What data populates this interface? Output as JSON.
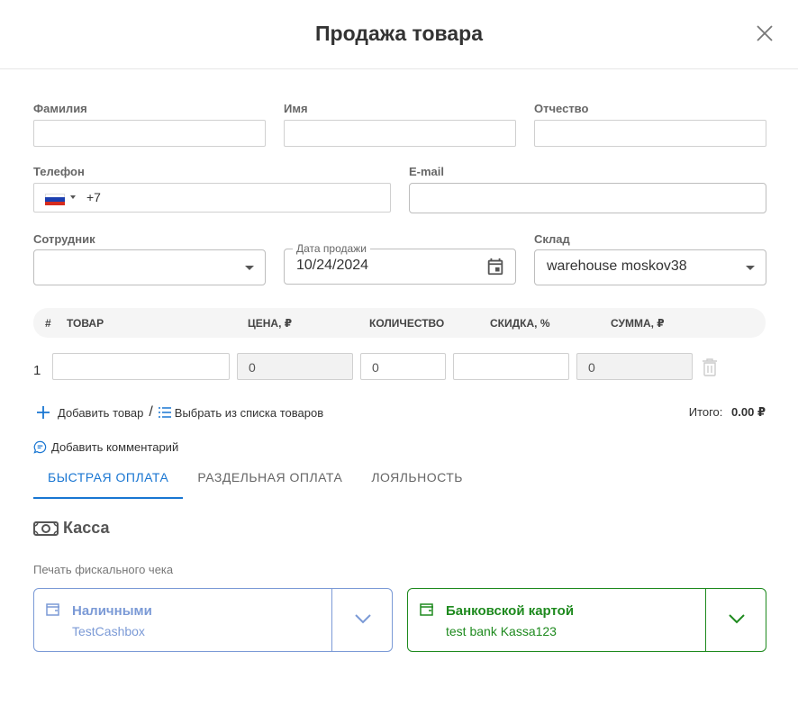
{
  "dialog": {
    "title": "Продажа товара"
  },
  "form": {
    "last_name_label": "Фамилия",
    "first_name_label": "Имя",
    "patronymic_label": "Отчество",
    "phone_label": "Телефон",
    "phone_dial_code": "+7",
    "email_label": "E-mail",
    "employee_label": "Сотрудник",
    "employee_value": "",
    "sale_date_label": "Дата продажи",
    "sale_date_value": "10/24/2024",
    "warehouse_label": "Склад",
    "warehouse_value": "warehouse moskov38"
  },
  "table": {
    "headers": [
      "#",
      "ТОВАР",
      "ЦЕНА, ₽",
      "КОЛИЧЕСТВО",
      "СКИДКА, %",
      "СУММА, ₽"
    ],
    "rows": [
      {
        "num": "1",
        "product": "",
        "price": "0",
        "quantity": "0",
        "discount": "",
        "sum": "0"
      }
    ]
  },
  "actions": {
    "add_product": "Добавить товар",
    "separator": "/",
    "choose_from_list": "Выбрать из списка товаров",
    "total_label": "Итого:",
    "total_value": "0.00 ₽",
    "add_comment": "Добавить комментарий"
  },
  "tabs": [
    "БЫСТРАЯ ОПЛАТА",
    "РАЗДЕЛЬНАЯ ОПЛАТА",
    "ЛОЯЛЬНОСТЬ"
  ],
  "cashbox": {
    "title": "Касса",
    "fiscal_label": "Печать фискального чека",
    "methods": [
      {
        "title": "Наличными",
        "subtitle": "TestCashbox",
        "color": "#7b9ad6"
      },
      {
        "title": "Банковской картой",
        "subtitle": "test bank Kassa123",
        "color": "#1e8a1e"
      }
    ]
  },
  "colors": {
    "accent": "#1976d2"
  }
}
